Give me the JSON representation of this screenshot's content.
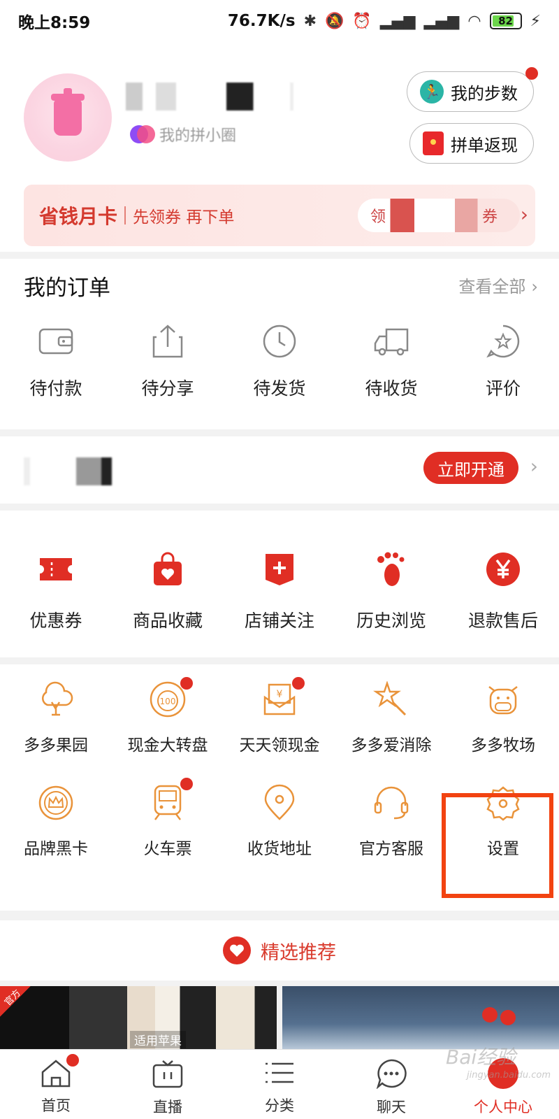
{
  "status_bar": {
    "time": "晚上8:59",
    "speed": "76.7K/s",
    "battery": "82"
  },
  "profile": {
    "pin_text": "我的拼小圈",
    "steps_label": "我的步数",
    "cashback_label": "拼单返现"
  },
  "save_card": {
    "title": "省钱月卡",
    "subtitle": "先领券 再下单",
    "coupon_left": "领",
    "coupon_right": "券"
  },
  "orders": {
    "title": "我的订单",
    "view_all": "查看全部",
    "items": [
      {
        "label": "待付款",
        "icon": "wallet-icon"
      },
      {
        "label": "待分享",
        "icon": "share-icon"
      },
      {
        "label": "待发货",
        "icon": "clock-icon"
      },
      {
        "label": "待收货",
        "icon": "truck-icon"
      },
      {
        "label": "评价",
        "icon": "review-icon"
      }
    ]
  },
  "vip": {
    "button": "立即开通"
  },
  "assets": {
    "items": [
      {
        "label": "优惠券",
        "icon": "coupon-icon"
      },
      {
        "label": "商品收藏",
        "icon": "favorite-bag-icon"
      },
      {
        "label": "店铺关注",
        "icon": "store-follow-icon"
      },
      {
        "label": "历史浏览",
        "icon": "footprint-icon"
      },
      {
        "label": "退款售后",
        "icon": "refund-icon"
      }
    ]
  },
  "tools": {
    "row1": [
      {
        "label": "多多果园",
        "icon": "tree-icon",
        "dot": false
      },
      {
        "label": "现金大转盘",
        "icon": "wheel-icon",
        "dot": true
      },
      {
        "label": "天天领现金",
        "icon": "cash-envelope-icon",
        "dot": true
      },
      {
        "label": "多多爱消除",
        "icon": "star-wand-icon",
        "dot": false
      },
      {
        "label": "多多牧场",
        "icon": "cow-icon",
        "dot": false
      }
    ],
    "row2": [
      {
        "label": "品牌黑卡",
        "icon": "crown-badge-icon",
        "dot": false
      },
      {
        "label": "火车票",
        "icon": "train-icon",
        "dot": true
      },
      {
        "label": "收货地址",
        "icon": "location-icon",
        "dot": false
      },
      {
        "label": "官方客服",
        "icon": "headset-icon",
        "dot": false
      },
      {
        "label": "设置",
        "icon": "settings-gear-icon",
        "dot": false
      }
    ]
  },
  "recommend": {
    "title": "精选推荐"
  },
  "products": {
    "left_tag": "官方",
    "left_text": "适用苹果"
  },
  "bottom_nav": [
    {
      "label": "首页",
      "icon": "home-icon"
    },
    {
      "label": "直播",
      "icon": "tv-icon"
    },
    {
      "label": "分类",
      "icon": "list-icon"
    },
    {
      "label": "聊天",
      "icon": "chat-icon"
    },
    {
      "label": "个人中心",
      "icon": "profile-icon"
    }
  ],
  "watermark": {
    "text": "Bai经验",
    "sub": "jingyan.baidu.com"
  },
  "colors": {
    "brand_red": "#e02e24",
    "tool_orange": "#e9933a",
    "highlight": "#f24311"
  }
}
